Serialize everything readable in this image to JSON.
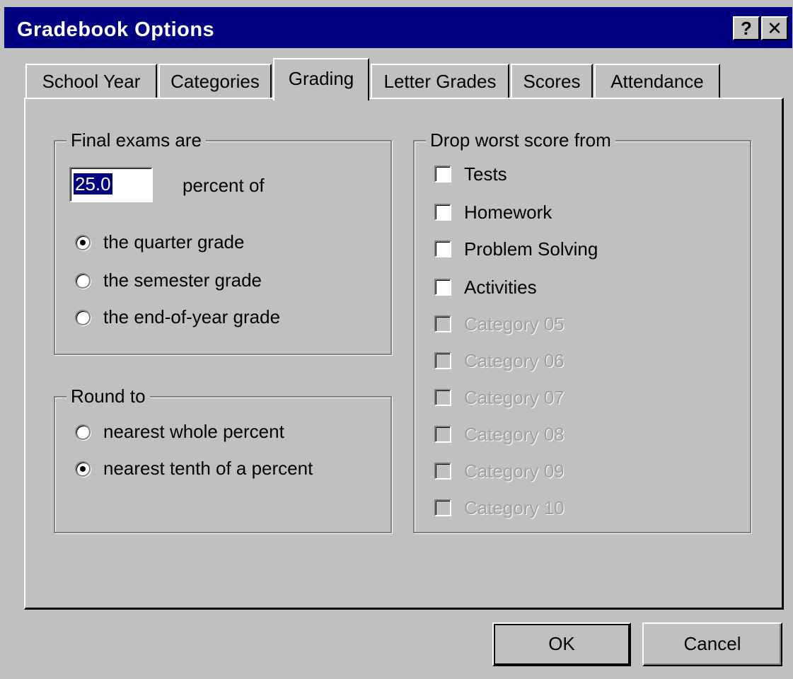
{
  "window": {
    "title": "Gradebook Options",
    "help_glyph": "?",
    "close_glyph": "✕"
  },
  "tabs": [
    {
      "label": "School Year"
    },
    {
      "label": "Categories"
    },
    {
      "label": "Grading",
      "active": true
    },
    {
      "label": "Letter Grades"
    },
    {
      "label": "Scores"
    },
    {
      "label": "Attendance"
    }
  ],
  "final_exams": {
    "group_label": "Final exams are",
    "percent_value": "25.0",
    "percent_suffix": "percent of",
    "options": [
      {
        "label": "the quarter grade",
        "selected": true
      },
      {
        "label": "the semester grade",
        "selected": false
      },
      {
        "label": "the end-of-year grade",
        "selected": false
      }
    ]
  },
  "round_to": {
    "group_label": "Round to",
    "options": [
      {
        "label": "nearest whole percent",
        "selected": false
      },
      {
        "label": "nearest tenth of a percent",
        "selected": true
      }
    ]
  },
  "drop_worst": {
    "group_label": "Drop worst score from",
    "items": [
      {
        "label": "Tests",
        "checked": false,
        "enabled": true
      },
      {
        "label": "Homework",
        "checked": false,
        "enabled": true
      },
      {
        "label": "Problem Solving",
        "checked": false,
        "enabled": true
      },
      {
        "label": "Activities",
        "checked": false,
        "enabled": true
      },
      {
        "label": "Category 05",
        "checked": false,
        "enabled": false
      },
      {
        "label": "Category 06",
        "checked": false,
        "enabled": false
      },
      {
        "label": "Category 07",
        "checked": false,
        "enabled": false
      },
      {
        "label": "Category 08",
        "checked": false,
        "enabled": false
      },
      {
        "label": "Category 09",
        "checked": false,
        "enabled": false
      },
      {
        "label": "Category 10",
        "checked": false,
        "enabled": false
      }
    ]
  },
  "buttons": {
    "ok": "OK",
    "cancel": "Cancel"
  },
  "colors": {
    "face": "#c0c0c0",
    "titlebar": "#000080",
    "selection": "#000080",
    "disabled_text": "#a0a0a0"
  }
}
